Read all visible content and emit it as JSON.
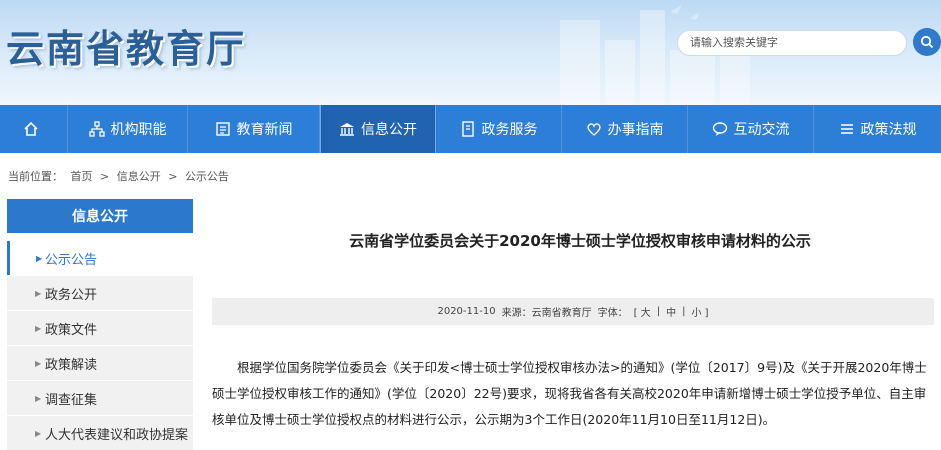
{
  "header": {
    "site_title": "云南省教育厅",
    "search_placeholder": "请输入搜索关键字"
  },
  "nav": {
    "items": [
      {
        "label": "",
        "icon": "home-icon"
      },
      {
        "label": "机构职能",
        "icon": "org-icon"
      },
      {
        "label": "教育新闻",
        "icon": "news-icon"
      },
      {
        "label": "信息公开",
        "icon": "building-icon",
        "active": true
      },
      {
        "label": "政务服务",
        "icon": "service-icon"
      },
      {
        "label": "办事指南",
        "icon": "heart-icon"
      },
      {
        "label": "互动交流",
        "icon": "chat-icon"
      },
      {
        "label": "政策法规",
        "icon": "list-icon"
      }
    ]
  },
  "breadcrumb": {
    "prefix": "当前位置：",
    "items": [
      "首页",
      ">",
      "信息公开",
      ">",
      "公示公告"
    ]
  },
  "sidebar": {
    "title": "信息公开",
    "items": [
      {
        "label": "公示公告",
        "active": true
      },
      {
        "label": "政务公开"
      },
      {
        "label": "政策文件"
      },
      {
        "label": "政策解读"
      },
      {
        "label": "调查征集"
      },
      {
        "label": "人大代表建议和政协提案"
      }
    ]
  },
  "article": {
    "title": "云南省学位委员会关于2020年博士硕士学位授权审核申请材料的公示",
    "date": "2020-11-10",
    "source": "来源：云南省教育厅",
    "font_label": "字体：",
    "font_sizes": [
      "[ 大",
      "|",
      "中",
      "|",
      "小 ]"
    ],
    "body": "根据学位国务院学位委员会《关于印发<博士硕士学位授权审核办法>的通知》(学位〔2017〕9号)及《关于开展2020年博士硕士学位授权审核工作的通知》(学位〔2020〕22号)要求，现将我省各有关高校2020年申请新增博士硕士学位授予单位、自主审核单位及博士硕士学位授权点的材料进行公示，公示期为3个工作日(2020年11月10日至11月12日)。"
  },
  "colors": {
    "nav_bg": "#2c7ed6",
    "nav_active": "#1f63b1",
    "sidebar_head": "#2b78cc",
    "title_blue": "#2a5f97"
  }
}
